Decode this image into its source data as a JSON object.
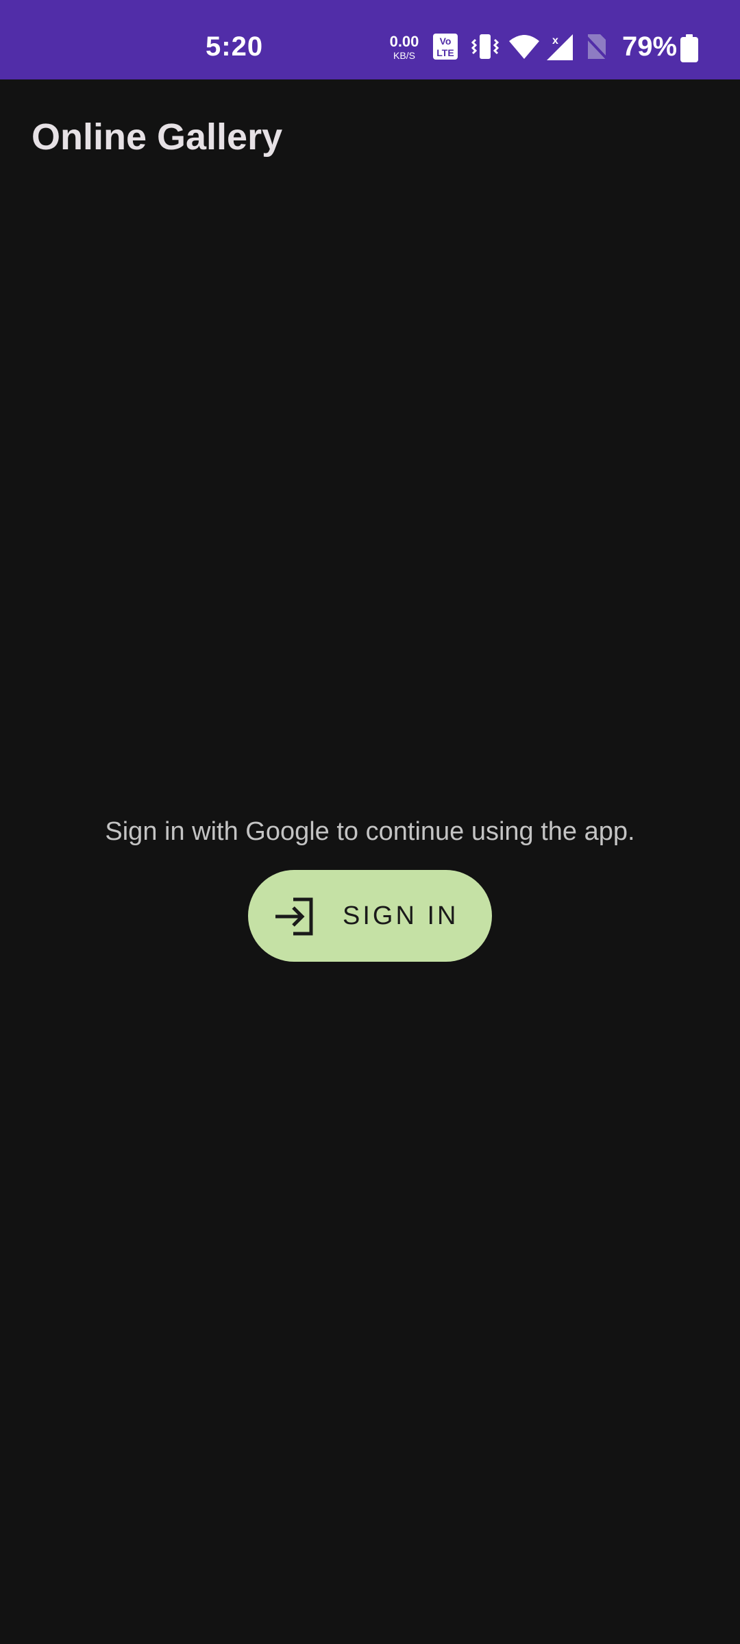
{
  "status_bar": {
    "time": "5:20",
    "net_speed_value": "0.00",
    "net_speed_unit": "KB/S",
    "volte_label_top": "Vo",
    "volte_label_bottom": "LTE",
    "battery_percent": "79%",
    "icons": [
      "volte-icon",
      "vibrate-icon",
      "wifi-icon",
      "signal-icon",
      "no-sim-icon",
      "battery-icon"
    ],
    "background_color": "#512DA8"
  },
  "app_bar": {
    "title": "Online Gallery"
  },
  "main": {
    "message": "Sign in with Google to continue using the app.",
    "sign_in_button": {
      "label": "SIGN IN",
      "icon": "login-icon",
      "background_color": "#C5E1A5"
    }
  }
}
